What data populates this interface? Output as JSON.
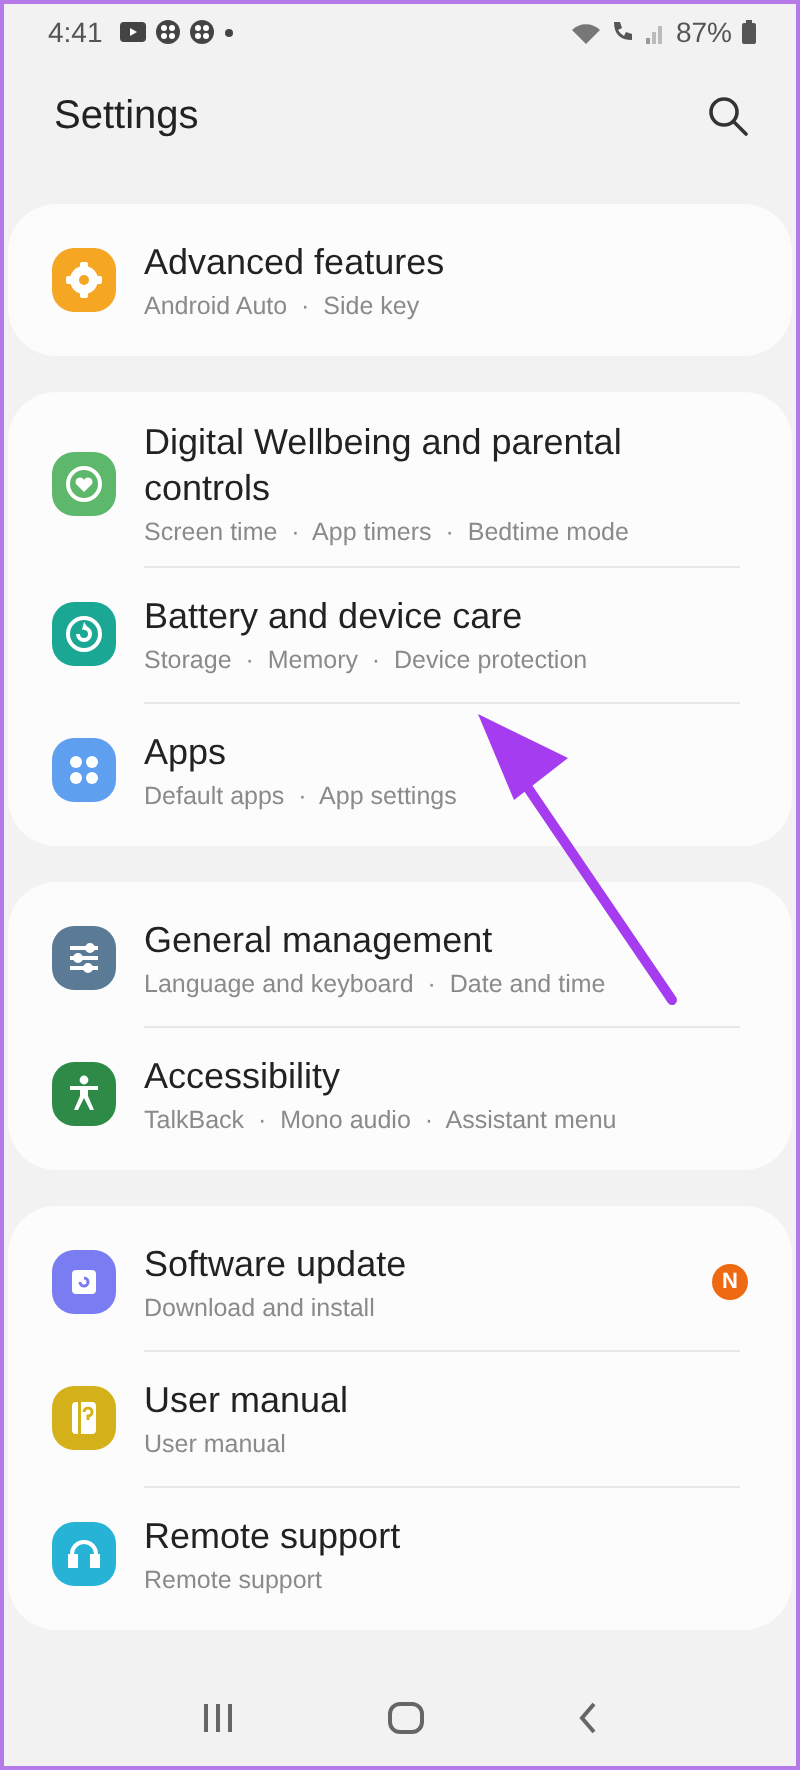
{
  "status_bar": {
    "time": "4:41",
    "battery": "87%"
  },
  "header": {
    "title": "Settings"
  },
  "groups": [
    {
      "items": [
        {
          "color": "#f5a623",
          "title": "Advanced features",
          "subtitle": "Android Auto  ·  Side key"
        }
      ]
    },
    {
      "items": [
        {
          "color": "#5db86b",
          "title": "Digital Wellbeing and parental controls",
          "subtitle": "Screen time  ·  App timers  ·  Bedtime mode"
        },
        {
          "color": "#1aa894",
          "title": "Battery and device care",
          "subtitle": "Storage  ·  Memory  ·  Device protection"
        },
        {
          "color": "#5f9ff0",
          "title": "Apps",
          "subtitle": "Default apps  ·  App settings"
        }
      ]
    },
    {
      "items": [
        {
          "color": "#5b7a95",
          "title": "General management",
          "subtitle": "Language and keyboard  ·  Date and time"
        },
        {
          "color": "#2e8b47",
          "title": "Accessibility",
          "subtitle": "TalkBack  ·  Mono audio  ·  Assistant menu"
        }
      ]
    },
    {
      "items": [
        {
          "color": "#7a7cf2",
          "title": "Software update",
          "subtitle": "Download and install",
          "badge": "N"
        },
        {
          "color": "#d4b11a",
          "title": "User manual",
          "subtitle": "User manual"
        },
        {
          "color": "#27b3d6",
          "title": "Remote support",
          "subtitle": "Remote support"
        }
      ]
    }
  ]
}
